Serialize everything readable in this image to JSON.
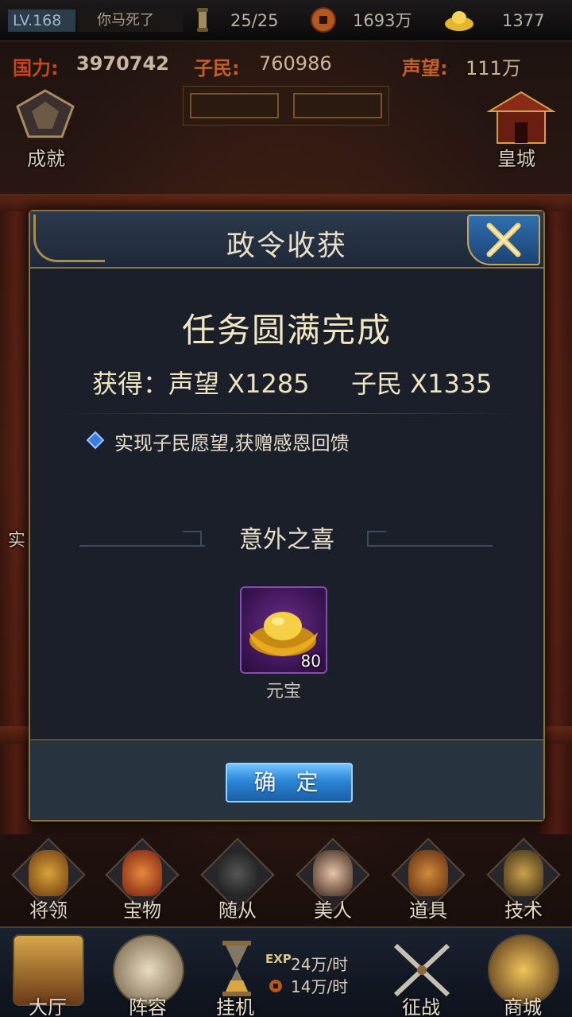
{
  "topbar": {
    "level": "LV.168",
    "player_name": "你马死了",
    "stamina": "25/25",
    "coins": "1693万",
    "ingots": "1377"
  },
  "stats": {
    "power_label": "国力:",
    "power_value": "3970742",
    "people_label": "子民:",
    "people_value": "760986",
    "prestige_label": "声望:",
    "prestige_value": "111万"
  },
  "side": {
    "achievement": "成就",
    "imperial_city": "皇城",
    "partial_left": "实"
  },
  "dialog": {
    "title": "政令收获",
    "complete_title": "任务圆满完成",
    "gain_prestige": "获得：声望 X1285",
    "gain_people": "子民 X1335",
    "description": "实现子民愿望,获赠感恩回馈",
    "bonus_title": "意外之喜",
    "item": {
      "name": "元宝",
      "count": "80"
    },
    "ok_label": "确 定"
  },
  "nav": {
    "items": [
      "将领",
      "宝物",
      "随从",
      "美人",
      "道具",
      "技术"
    ]
  },
  "bottom": {
    "hall": "大厅",
    "lineup": "阵容",
    "afk": "挂机",
    "exp_rate": "24万/时",
    "coin_rate": "14万/时",
    "exp_label": "EXP",
    "battle": "征战",
    "shop": "商城"
  },
  "colors": {
    "accent_gold": "#c9a551",
    "button_blue": "#2b86d6",
    "power_red": "#c9471c",
    "item_purple": "#6a2e8a"
  }
}
